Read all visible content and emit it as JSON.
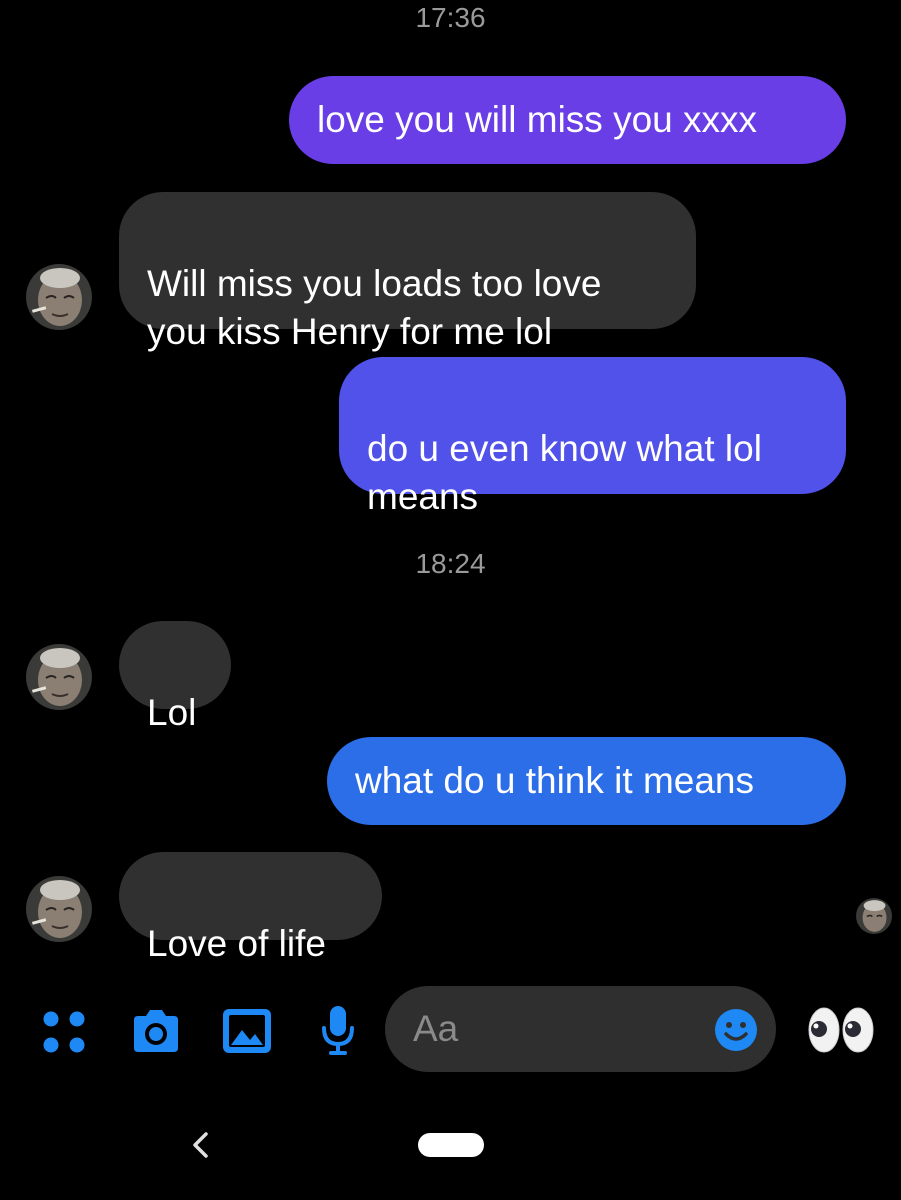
{
  "timestamps": [
    "17:36",
    "18:24"
  ],
  "messages": [
    {
      "id": "m1",
      "direction": "outgoing",
      "text": "love you will miss you xxxx",
      "color": "#6a3ee6"
    },
    {
      "id": "m2",
      "direction": "incoming",
      "text": "Will miss you loads too love\nyou kiss Henry for me lol",
      "color": "#303030"
    },
    {
      "id": "m3",
      "direction": "outgoing",
      "text": "do u even know what lol\nmeans",
      "color": "#5052ea"
    },
    {
      "id": "m4",
      "direction": "incoming",
      "text": "Lol",
      "color": "#303030"
    },
    {
      "id": "m5",
      "direction": "outgoing",
      "text": "what do u think it means",
      "color": "#2c6de8"
    },
    {
      "id": "m6",
      "direction": "incoming",
      "text": "Love of life",
      "color": "#303030"
    }
  ],
  "composer": {
    "placeholder": "Aa",
    "icons": [
      "apps-icon",
      "camera-icon",
      "gallery-icon",
      "microphone-icon",
      "emoji-icon",
      "eyes-emoji-icon"
    ],
    "accent_color": "#1e88f5"
  },
  "navigation": {
    "icons": [
      "back-icon",
      "home-pill"
    ]
  }
}
